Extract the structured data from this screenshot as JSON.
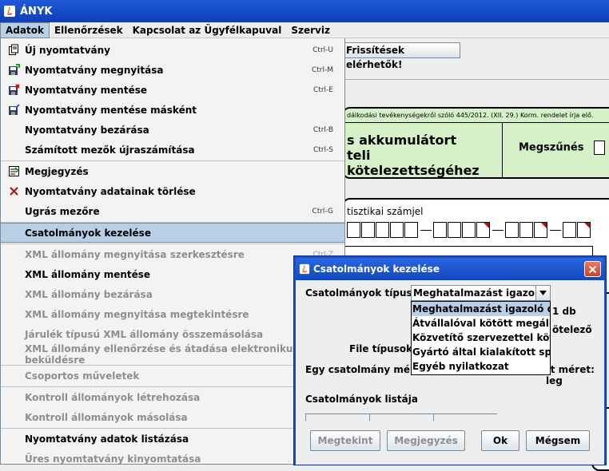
{
  "window": {
    "title": "ÁNYK"
  },
  "menubar": {
    "items": [
      "Adatok",
      "Ellenőrzések",
      "Kapcsolat az Ügyfélkapuval",
      "Szerviz"
    ]
  },
  "background": {
    "update_label": "Frissítések elérhetők!",
    "law_text": "dálkodási tevékenységekről szóló 445/2012. (XII. 29.) Korm. rendelet írja elő.",
    "form_title_1": "s akkumulátort",
    "form_title_2": "teli kötelezettségéhez",
    "megszunes": "Megszűnés",
    "stat_label": "tisztikai számjel"
  },
  "menu": {
    "items": [
      {
        "label": "Új nyomtatvány",
        "shortcut": "Ctrl-U",
        "icon": "new-form-icon",
        "enabled": true
      },
      {
        "label": "Nyomtatvány megnyitása",
        "shortcut": "Ctrl-M",
        "icon": "open-form-icon",
        "enabled": true
      },
      {
        "label": "Nyomtatvány mentése",
        "shortcut": "Ctrl-E",
        "icon": "save-form-icon",
        "enabled": true
      },
      {
        "label": "Nyomtatvány mentése másként",
        "shortcut": "",
        "icon": "save-as-icon",
        "enabled": true
      },
      {
        "label": "Nyomtatvány bezárása",
        "shortcut": "Ctrl-B",
        "icon": "",
        "enabled": true
      },
      {
        "label": "Számított mezők újraszámítása",
        "shortcut": "Ctrl-S",
        "icon": "",
        "enabled": true
      },
      {
        "label": "Megjegyzés",
        "shortcut": "",
        "icon": "note-icon",
        "enabled": true
      },
      {
        "label": "Nyomtatvány adatainak törlése",
        "shortcut": "",
        "icon": "delete-x-icon",
        "enabled": true
      },
      {
        "label": "Ugrás mezőre",
        "shortcut": "Ctrl-G",
        "icon": "",
        "enabled": true
      },
      {
        "label": "Csatolmányok kezelése",
        "shortcut": "",
        "icon": "",
        "enabled": true
      },
      {
        "label": "XML állomány megnyitása szerkesztésre",
        "shortcut": "Ctrl-Z",
        "icon": "",
        "enabled": false
      },
      {
        "label": "XML állomány mentése",
        "shortcut": "",
        "icon": "",
        "enabled": true
      },
      {
        "label": "XML állomány bezárása",
        "shortcut": "",
        "icon": "",
        "enabled": false
      },
      {
        "label": "XML állomány megnyitása megtekintésre",
        "shortcut": "",
        "icon": "",
        "enabled": false
      },
      {
        "label": "Járulék típusú XML állomány összemásolása",
        "shortcut": "",
        "icon": "",
        "enabled": false
      },
      {
        "label": "XML állomány ellenőrzése és átadása elektronikus beküldésre",
        "shortcut": "",
        "icon": "",
        "enabled": false
      },
      {
        "label": "Csoportos műveletek",
        "shortcut": "",
        "icon": "",
        "enabled": false
      },
      {
        "label": "Kontroll állományok létrehozása",
        "shortcut": "",
        "icon": "",
        "enabled": false
      },
      {
        "label": "Kontroll állományok másolása",
        "shortcut": "",
        "icon": "",
        "enabled": false
      },
      {
        "label": "Nyomtatvány adatok listázása",
        "shortcut": "",
        "icon": "",
        "enabled": true
      },
      {
        "label": "Üres nyomtatvány kinyomtatása",
        "shortcut": "",
        "icon": "",
        "enabled": false
      }
    ]
  },
  "dialog": {
    "title": "Csatolmányok kezelése",
    "type_label": "Csatolmányok típusa:",
    "combo_value": "Meghatalmazást igazoló ...",
    "options": [
      "Meghatalmazást igazoló dokumentum",
      "Átvállalóval kötött megállapodás",
      "Közvetítő szervezettel kötött megállapodás",
      "Gyártó által kialakított speciális",
      "Egyéb nyilatkozat"
    ],
    "count_suffix": "1 db",
    "required_suffix": "ötelező",
    "file_types_label": "File típusok:",
    "single_size_label": "Egy csatolmány mérete",
    "total_size_label": "tt méret: leg",
    "list_label": "Csatolmányok listája",
    "buttons": {
      "view": "Megtekint",
      "note": "Megjegyzés",
      "ok": "Ok",
      "cancel": "Mégsem"
    }
  }
}
